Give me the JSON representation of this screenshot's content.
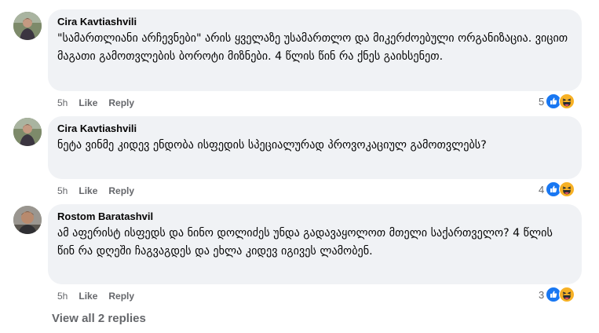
{
  "comments": [
    {
      "author": "Cira Kavtiashvili",
      "text": "\"სამართლიანი არჩევნები\" არის ყველაზე უსამართლო და მიკერძოებული ორგანიზაცია. ვიცით მაგათი გამოთვლების ბოროტი მიზნები. 4 წლის წინ რა ქნეს გაიხსენეთ.",
      "time": "5h",
      "like_label": "Like",
      "reply_label": "Reply",
      "reaction_count": "5",
      "reactions": [
        "like-icon",
        "haha-icon"
      ]
    },
    {
      "author": "Cira Kavtiashvili",
      "text": "ნეტა ვინმე კიდევ ენდობა ისფედის სპეციალურად პროვოკაციულ გამოთვლებს?",
      "time": "5h",
      "like_label": "Like",
      "reply_label": "Reply",
      "reaction_count": "4",
      "reactions": [
        "like-icon",
        "haha-icon"
      ]
    },
    {
      "author": "Rostom Baratashvil",
      "text": "ამ აფერისტ ისფედს და ნინო დოლიძეს უნდა გადავაყოლოთ მთელი საქართველო? 4 წლის წინ რა დღეში ჩაგვაგდეს და ეხლა კიდევ იგივეს ლამობენ.",
      "time": "5h",
      "like_label": "Like",
      "reply_label": "Reply",
      "reaction_count": "3",
      "reactions": [
        "like-icon",
        "haha-icon"
      ]
    }
  ],
  "view_replies_label": "View all 2 replies",
  "colors": {
    "bubble": "#f0f2f5",
    "meta_text": "#65676b",
    "like_blue": "#1877f2",
    "haha_yellow": "#f7b125"
  }
}
